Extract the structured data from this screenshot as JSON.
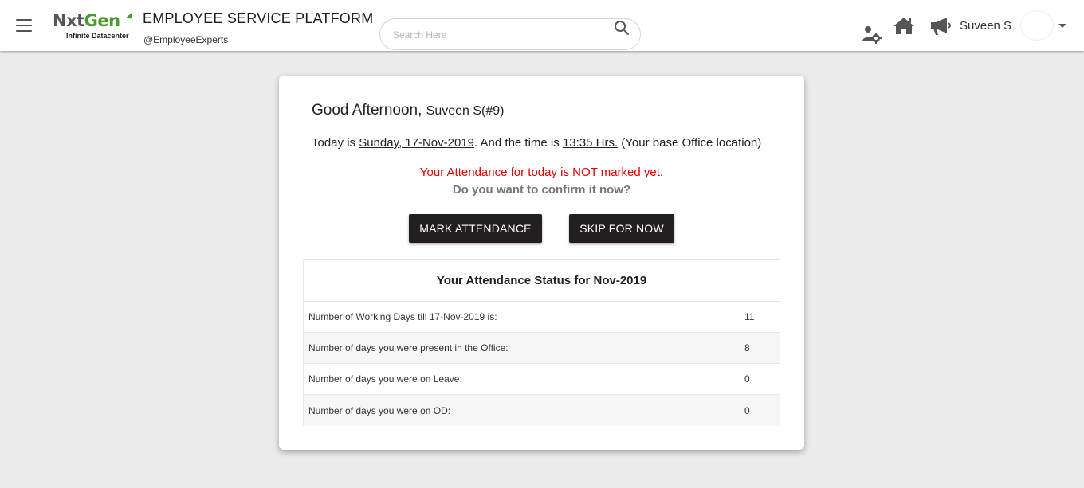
{
  "header": {
    "logo_primary": "NxtGen",
    "logo_tagline": "Infinite Datacenter",
    "title": "EMPLOYEE SERVICE PLATFORM",
    "subtitle": "@EmployeeExperts",
    "search_placeholder": "Search Here",
    "user_name": "Suveen S",
    "icons": [
      "menu-icon",
      "search-icon",
      "team-settings-icon",
      "home-icon",
      "megaphone-icon",
      "dropdown-caret-icon"
    ]
  },
  "card": {
    "greeting": "Good Afternoon,",
    "greeting_name": "Suveen S(#9)",
    "today_prefix": "Today is",
    "today_date": "Sunday, 17-Nov-2019",
    "today_mid": ". And the time is",
    "today_time": "13:35 Hrs.",
    "today_suffix": "(Your base Office location)",
    "warning": "Your Attendance for today is NOT marked yet.",
    "question": "Do you want to confirm it now?",
    "mark_button": "MARK ATTENDANCE",
    "skip_button": "SKIP FOR NOW"
  },
  "status": {
    "title": "Your Attendance Status for Nov-2019",
    "rows": [
      {
        "label": "Number of Working Days till 17-Nov-2019 is:",
        "value": "11"
      },
      {
        "label": "Number of days you were present in the Office:",
        "value": "8"
      },
      {
        "label": "Number of days you were on Leave:",
        "value": "0"
      },
      {
        "label": "Number of days you were on OD:",
        "value": "0"
      }
    ]
  },
  "colors": {
    "page_bg": "#ebebeb",
    "button_bg": "#231f20",
    "warning_text": "#e50000",
    "logo_green": "#4a9a2e"
  }
}
